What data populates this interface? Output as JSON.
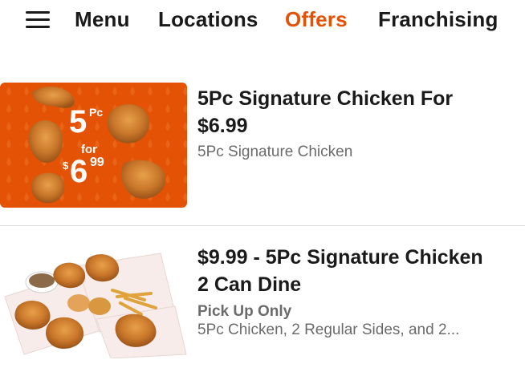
{
  "nav": {
    "menu_label": "Menu",
    "locations_label": "Locations",
    "offers_label": "Offers",
    "franchising_label": "Franchising",
    "active_color": "#e35205"
  },
  "offers": [
    {
      "title_line1": "5Pc Signature Chicken For",
      "title_line2": "$6.99",
      "subtitle": "5Pc Signature Chicken",
      "image": {
        "count_text": "5",
        "unit_text": "Pc",
        "for_text": "for",
        "dollar_text": "$",
        "price_whole": "6",
        "price_cents": "99",
        "background_color": "#e35205"
      }
    },
    {
      "title_line1": "$9.99 - 5Pc Signature Chicken",
      "title_line2": "2 Can Dine",
      "badge": "Pick Up Only",
      "subtitle": "5Pc Chicken, 2 Regular Sides, and 2..."
    }
  ]
}
